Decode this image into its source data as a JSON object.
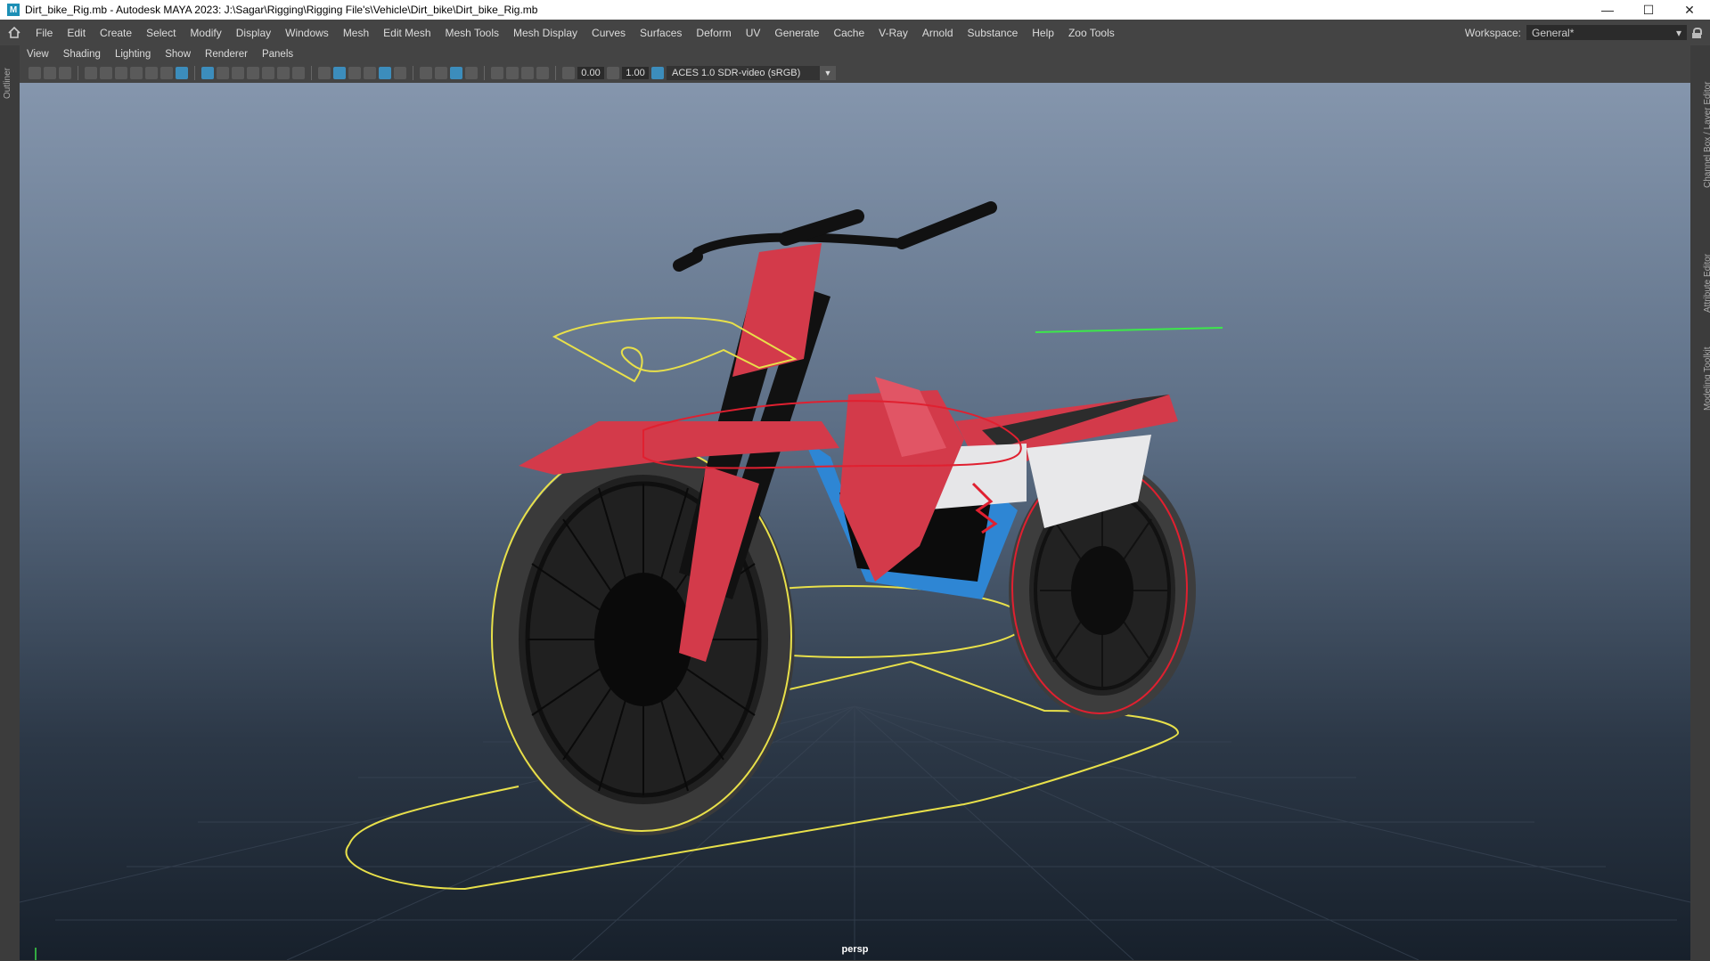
{
  "title": "Dirt_bike_Rig.mb - Autodesk MAYA 2023: J:\\Sagar\\Rigging\\Rigging File's\\Vehicle\\Dirt_bike\\Dirt_bike_Rig.mb",
  "app_icon": "M",
  "window_buttons": {
    "minimize": "—",
    "maximize": "☐",
    "close": "✕"
  },
  "menu": [
    "File",
    "Edit",
    "Create",
    "Select",
    "Modify",
    "Display",
    "Windows",
    "Mesh",
    "Edit Mesh",
    "Mesh Tools",
    "Mesh Display",
    "Curves",
    "Surfaces",
    "Deform",
    "UV",
    "Generate",
    "Cache",
    "V-Ray",
    "Arnold",
    "Substance",
    "Help",
    "Zoo Tools"
  ],
  "workspace": {
    "label": "Workspace:",
    "value": "General*"
  },
  "panel_menu": [
    "View",
    "Shading",
    "Lighting",
    "Show",
    "Renderer",
    "Panels"
  ],
  "toolbar": {
    "field_a": "0.00",
    "field_b": "1.00",
    "color_space": "ACES 1.0 SDR-video (sRGB)"
  },
  "left_strip": {
    "label": "Outliner"
  },
  "right_strip": {
    "labels": [
      "Channel Box / Layer Editor",
      "Attribute Editor",
      "Modeling Toolkit"
    ]
  },
  "viewport": {
    "camera": "persp"
  },
  "colors": {
    "accent": "#3c8dbc",
    "body_red": "#d33a4a",
    "frame_blue": "#2e86d4",
    "control_yellow": "#e8e04a",
    "control_red": "#e02030"
  }
}
